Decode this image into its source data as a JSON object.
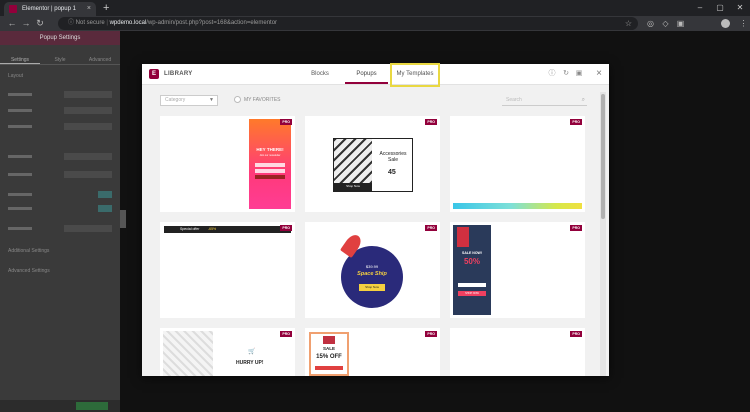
{
  "browser": {
    "tab_title": "Elementor | popup 1",
    "tab_close": "×",
    "new_tab": "+",
    "url_warning": "ⓘ Not secure",
    "url_host": "wpdemo.local",
    "url_path": "/wp-admin/post.php?post=168&action=elementor",
    "back": "←",
    "forward": "→",
    "reload": "↻"
  },
  "editor": {
    "panel_title": "Popup Settings",
    "panel_tabs": [
      "Settings",
      "Style",
      "Advanced"
    ],
    "section_labels": [
      "Layout",
      "Additional Settings",
      "Advanced Settings"
    ],
    "publish_label": "PUBLISH"
  },
  "library": {
    "title": "LIBRARY",
    "tabs": [
      "Blocks",
      "Popups",
      "My Templates"
    ],
    "active_tab": 1,
    "category_placeholder": "Category",
    "favorites_label": "MY FAVORITES",
    "search_placeholder": "Search",
    "pro_badge": "PRO",
    "templates": [
      {
        "headline": "HEY THERE!",
        "sub": "Join our newsletter"
      },
      {
        "headline": "Accessories Sale",
        "value": "45",
        "button": "Shop Now"
      },
      {
        "headline": ""
      },
      {
        "headline": "Special offer",
        "value": "-65%"
      },
      {
        "price": "$39.99",
        "headline": "Space Ship",
        "button": "Shop Now"
      },
      {
        "headline": "SALE NOW!",
        "value": "50%",
        "button": "SHOP NOW"
      },
      {
        "headline": "HURRY UP!"
      },
      {
        "headline": "SALE",
        "value": "15% OFF"
      },
      {
        "headline": ""
      }
    ]
  },
  "colors": {
    "brand": "#92003b",
    "highlight": "#e9d842"
  }
}
